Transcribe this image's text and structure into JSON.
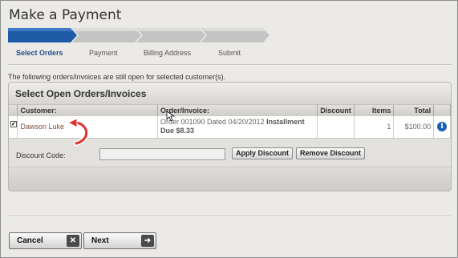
{
  "page": {
    "title": "Make a Payment"
  },
  "steps": [
    {
      "label": "Select Orders",
      "active": true
    },
    {
      "label": "Payment",
      "active": false
    },
    {
      "label": "Billing Address",
      "active": false
    },
    {
      "label": "Submit",
      "active": false
    }
  ],
  "intro_text": "The following orders/invoices are still open for selected customer(s).",
  "panel": {
    "title": "Select Open Orders/Invoices",
    "columns": [
      "Customer:",
      "Order/Invoice:",
      "Discount",
      "Items",
      "Total"
    ],
    "rows": [
      {
        "checked": true,
        "customer": "Dawson Luke",
        "order_text": "Order 001090 Dated 04/20/2012",
        "order_bold": "Installment Due $8.33",
        "discount": "",
        "items": "1",
        "total": "$100.00",
        "info_icon": "info-icon"
      }
    ],
    "discount_label": "Discount Code:",
    "discount_value": "",
    "apply_label": "Apply Discount",
    "remove_label": "Remove Discount"
  },
  "buttons": {
    "cancel": {
      "label": "Cancel",
      "icon": "close-icon"
    },
    "next": {
      "label": "Next",
      "icon": "arrow-right-icon"
    }
  },
  "colors": {
    "active_step": "#1f5aa6",
    "inactive_step": "#c4c4c4",
    "annotation_arrow": "#e0312e"
  }
}
